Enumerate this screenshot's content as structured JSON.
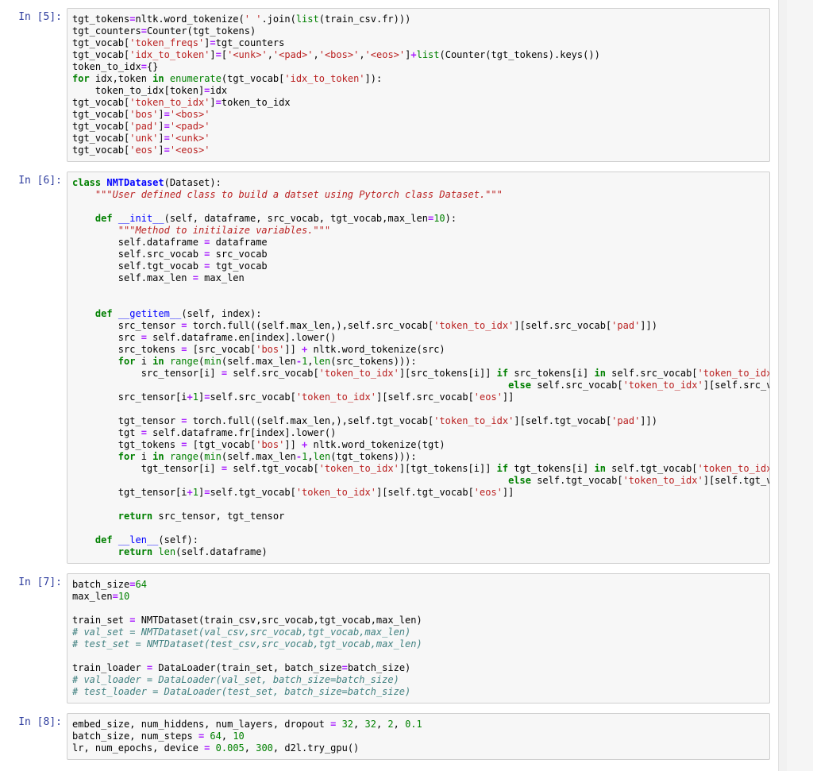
{
  "cells": [
    {
      "prompt": "In [5]:",
      "code_html": "tgt_tokens<span class='op'>=</span>nltk.word_tokenize(<span class='str'>' '</span>.join(<span class='bi'>list</span>(train_csv.fr)))\ntgt_counters<span class='op'>=</span>Counter(tgt_tokens)\ntgt_vocab[<span class='str'>'token_freqs'</span>]<span class='op'>=</span>tgt_counters\ntgt_vocab[<span class='str'>'idx_to_token'</span>]<span class='op'>=</span>[<span class='str'>'&lt;unk&gt;'</span>,<span class='str'>'&lt;pad&gt;'</span>,<span class='str'>'&lt;bos&gt;'</span>,<span class='str'>'&lt;eos&gt;'</span>]<span class='op'>+</span><span class='bi'>list</span>(Counter(tgt_tokens).keys())\ntoken_to_idx<span class='op'>=</span>{}\n<span class='kw'>for</span> idx,token <span class='kw'>in</span> <span class='bi'>enumerate</span>(tgt_vocab[<span class='str'>'idx_to_token'</span>]):\n    token_to_idx[token]<span class='op'>=</span>idx\ntgt_vocab[<span class='str'>'token_to_idx'</span>]<span class='op'>=</span>token_to_idx\ntgt_vocab[<span class='str'>'bos'</span>]<span class='op'>=</span><span class='str'>'&lt;bos&gt;'</span>\ntgt_vocab[<span class='str'>'pad'</span>]<span class='op'>=</span><span class='str'>'&lt;pad&gt;'</span>\ntgt_vocab[<span class='str'>'unk'</span>]<span class='op'>=</span><span class='str'>'&lt;unk&gt;'</span>\ntgt_vocab[<span class='str'>'eos'</span>]<span class='op'>=</span><span class='str'>'&lt;eos&gt;'</span>"
    },
    {
      "prompt": "In [6]:",
      "scroll": true,
      "code_html": "<span class='kw'>class</span> <span class='cls'>NMTDataset</span>(Dataset):\n    <span class='doc'>\"\"\"User defined class to build a datset using Pytorch class Dataset.\"\"\"</span>\n\n    <span class='kw'>def</span> <span class='fn'>__init__</span>(self, dataframe, src_vocab, tgt_vocab,max_len<span class='op'>=</span><span class='num'>10</span>):\n        <span class='doc'>\"\"\"Method to initilaize variables.\"\"\"</span>\n        self.dataframe <span class='op'>=</span> dataframe\n        self.src_vocab <span class='op'>=</span> src_vocab\n        self.tgt_vocab <span class='op'>=</span> tgt_vocab\n        self.max_len <span class='op'>=</span> max_len\n\n\n    <span class='kw'>def</span> <span class='fn'>__getitem__</span>(self, index):\n        src_tensor <span class='op'>=</span> torch.full((self.max_len,),self.src_vocab[<span class='str'>'token_to_idx'</span>][self.src_vocab[<span class='str'>'pad'</span>]])\n        src <span class='op'>=</span> self.dataframe.en[index].lower()\n        src_tokens <span class='op'>=</span> [src_vocab[<span class='str'>'bos'</span>]] <span class='op'>+</span> nltk.word_tokenize(src)\n        <span class='kw'>for</span> i <span class='kw'>in</span> <span class='bi'>range</span>(<span class='bi'>min</span>(self.max_len<span class='op'>-</span><span class='num'>1</span>,<span class='bi'>len</span>(src_tokens))):\n            src_tensor[i] <span class='op'>=</span> self.src_vocab[<span class='str'>'token_to_idx'</span>][src_tokens[i]] <span class='kw'>if</span> src_tokens[i] <span class='kw'>in</span> self.src_vocab[<span class='str'>'token_to_idx'</span>] \\\n                                                                            <span class='kw'>else</span> self.src_vocab[<span class='str'>'token_to_idx'</span>][self.src_vocab[<span class='str'>'unk'</span>]]\n        src_tensor[i<span class='op'>+</span><span class='num'>1</span>]<span class='op'>=</span>self.src_vocab[<span class='str'>'token_to_idx'</span>][self.src_vocab[<span class='str'>'eos'</span>]]\n\n        tgt_tensor <span class='op'>=</span> torch.full((self.max_len,),self.tgt_vocab[<span class='str'>'token_to_idx'</span>][self.tgt_vocab[<span class='str'>'pad'</span>]])\n        tgt <span class='op'>=</span> self.dataframe.fr[index].lower()\n        tgt_tokens <span class='op'>=</span> [tgt_vocab[<span class='str'>'bos'</span>]] <span class='op'>+</span> nltk.word_tokenize(tgt)\n        <span class='kw'>for</span> i <span class='kw'>in</span> <span class='bi'>range</span>(<span class='bi'>min</span>(self.max_len<span class='op'>-</span><span class='num'>1</span>,<span class='bi'>len</span>(tgt_tokens))):\n            tgt_tensor[i] <span class='op'>=</span> self.tgt_vocab[<span class='str'>'token_to_idx'</span>][tgt_tokens[i]] <span class='kw'>if</span> tgt_tokens[i] <span class='kw'>in</span> self.tgt_vocab[<span class='str'>'token_to_idx'</span>] \\\n                                                                            <span class='kw'>else</span> self.tgt_vocab[<span class='str'>'token_to_idx'</span>][self.tgt_vocab[<span class='str'>'unk'</span>]]\n        tgt_tensor[i<span class='op'>+</span><span class='num'>1</span>]<span class='op'>=</span>self.tgt_vocab[<span class='str'>'token_to_idx'</span>][self.tgt_vocab[<span class='str'>'eos'</span>]]\n\n        <span class='kw'>return</span> src_tensor, tgt_tensor\n\n    <span class='kw'>def</span> <span class='fn'>__len__</span>(self):\n        <span class='kw'>return</span> <span class='bi'>len</span>(self.dataframe)"
    },
    {
      "prompt": "In [7]:",
      "code_html": "batch_size<span class='op'>=</span><span class='num'>64</span>\nmax_len<span class='op'>=</span><span class='num'>10</span>\n\ntrain_set <span class='op'>=</span> NMTDataset(train_csv,src_vocab,tgt_vocab,max_len)\n<span class='cm'># val_set = NMTDataset(val_csv,src_vocab,tgt_vocab,max_len)</span>\n<span class='cm'># test_set = NMTDataset(test_csv,src_vocab,tgt_vocab,max_len)</span>\n\ntrain_loader <span class='op'>=</span> DataLoader(train_set, batch_size<span class='op'>=</span>batch_size)\n<span class='cm'># val_loader = DataLoader(val_set, batch_size=batch_size)</span>\n<span class='cm'># test_loader = DataLoader(test_set, batch_size=batch_size)</span>"
    },
    {
      "prompt": "In [8]:",
      "code_html": "embed_size, num_hiddens, num_layers, dropout <span class='op'>=</span> <span class='num'>32</span>, <span class='num'>32</span>, <span class='num'>2</span>, <span class='num'>0.1</span>\nbatch_size, num_steps <span class='op'>=</span> <span class='num'>64</span>, <span class='num'>10</span>\nlr, num_epochs, device <span class='op'>=</span> <span class='num'>0.005</span>, <span class='num'>300</span>, d2l.try_gpu()"
    }
  ]
}
